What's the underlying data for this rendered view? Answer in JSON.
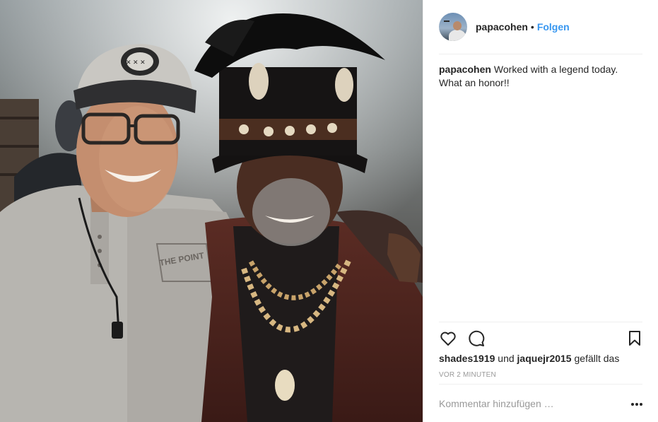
{
  "post": {
    "image_alt": "photo",
    "author": {
      "username": "papacohen",
      "separator": "•",
      "follow_label": "Folgen",
      "avatar_icon": "avatar-photo"
    },
    "caption": {
      "username": "papacohen",
      "text": "Worked with a legend today. What an honor!!"
    },
    "actions": {
      "like_icon": "heart-outline-icon",
      "comment_icon": "speech-bubble-icon",
      "save_icon": "bookmark-outline-icon"
    },
    "likes": {
      "user1": "shades1919",
      "joiner": "und",
      "user2": "jaquejr2015",
      "suffix": "gefällt das"
    },
    "timestamp": "VOR 2 MINUTEN",
    "comment_box": {
      "placeholder": "Kommentar hinzufügen …",
      "more_icon": "more-options-icon"
    },
    "colors": {
      "accent": "#3897f0",
      "text": "#262626",
      "muted": "#999999",
      "divider": "#efefef"
    }
  }
}
